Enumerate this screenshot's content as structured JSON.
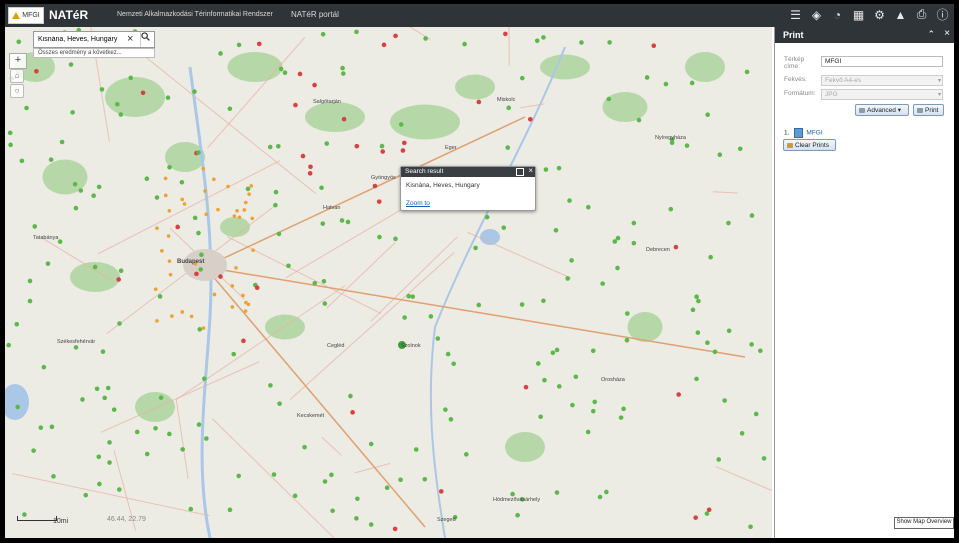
{
  "header": {
    "logo_text": "MFGI",
    "app_title": "NATéR",
    "subtitle": "Nemzeti Alkalmazkodási Térinformatikai Rendszer",
    "portal_link": "NATéR portál",
    "toolbar_icons": [
      "list-icon",
      "layers-icon",
      "dashboard-icon",
      "grid-icon",
      "tools-icon",
      "graduation-icon",
      "print-icon",
      "info-icon"
    ]
  },
  "search": {
    "value": "Kisnána, Heves, Hungary",
    "dropdown_text": "Összes eredmény a következ..."
  },
  "popup": {
    "title": "Search result",
    "body": "Kisnána, Heves, Hungary",
    "zoom_link": "Zoom to"
  },
  "map": {
    "scale_label": "10mi",
    "coords": "46.44, 22.79",
    "cities": [
      "Salgótarján",
      "Miskolc",
      "Eger",
      "Budapest",
      "Tatabánya",
      "Székesfehérvár",
      "Debrecen",
      "Nyíregyháza",
      "Szolnok",
      "Kecskemét",
      "Hódmezővásárhely",
      "Szeged",
      "Orosháza",
      "Gyöngyös",
      "Hatvan",
      "Cegléd"
    ]
  },
  "print_panel": {
    "title": "Print",
    "map_title_label": "Térkép címe:",
    "map_title_value": "MFGI",
    "layout_label": "Fekvés:",
    "layout_value": "Fekvő A4-es",
    "format_label": "Formátum:",
    "format_value": "JPG",
    "advanced_label": "Advanced",
    "print_label": "Print",
    "print_item_index": "1.",
    "print_item_name": "MFGI",
    "clear_label": "Clear Prints"
  },
  "overview_button": "Show Map Overview",
  "colors": {
    "header_bg": "#2f3438",
    "map_bg": "#ecebe4",
    "forest": "#a9d39a",
    "dot_green": "#5cb84a",
    "dot_red": "#d94040",
    "dot_orange": "#f0a030",
    "road": "#e8b0a0",
    "water": "#aac7e8"
  }
}
